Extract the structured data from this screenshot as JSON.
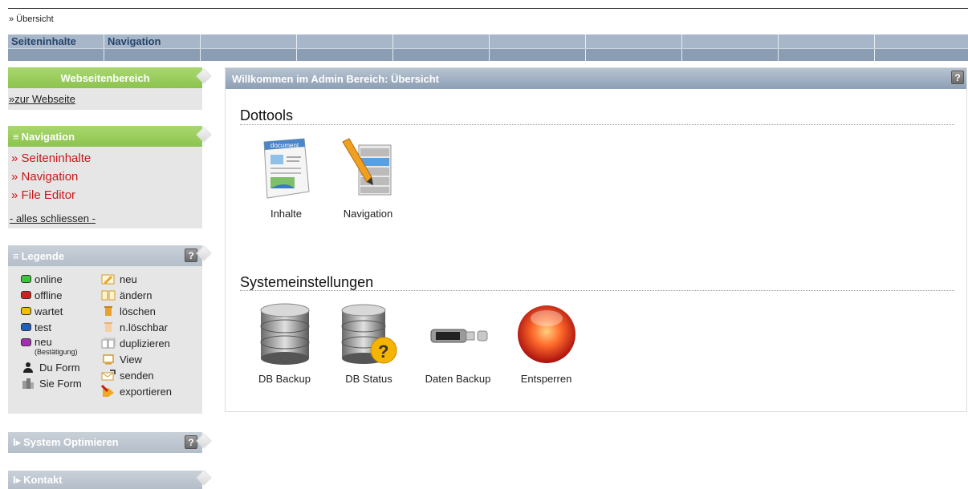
{
  "breadcrumb": "» Übersicht",
  "topnav": {
    "items": [
      "Seiteninhalte",
      "Navigation",
      "",
      "",
      "",
      "",
      "",
      "",
      "",
      ""
    ]
  },
  "sidebar": {
    "webseitenbereich": {
      "title": "Webseitenbereich",
      "link": "»zur Webseite"
    },
    "navigation": {
      "title": "Navigation",
      "links": [
        "» Seiteninhalte",
        "» Navigation",
        "» File Editor"
      ],
      "close_all": "- alles schliessen -"
    },
    "legende": {
      "title": "Legende",
      "left": [
        {
          "label": "online",
          "color": "#3cc43c"
        },
        {
          "label": "offline",
          "color": "#d02020"
        },
        {
          "label": "wartet",
          "color": "#f0c000"
        },
        {
          "label": "test",
          "color": "#1f5fb8"
        },
        {
          "label": "neu",
          "sub": "(Bestätigung)",
          "color": "#a030b0"
        },
        {
          "label": "Du Form",
          "icon": "person-icon"
        },
        {
          "label": "Sie Form",
          "icon": "building-icon"
        }
      ],
      "right": [
        {
          "label": "neu",
          "icon": "pencil-icon"
        },
        {
          "label": "ändern",
          "icon": "book-icon"
        },
        {
          "label": "löschen",
          "icon": "trash-icon"
        },
        {
          "label": "n.löschbar",
          "icon": "trash-disabled-icon"
        },
        {
          "label": "duplizieren",
          "icon": "duplicate-icon"
        },
        {
          "label": "View",
          "icon": "monitor-icon"
        },
        {
          "label": "senden",
          "icon": "envelope-icon"
        },
        {
          "label": "exportieren",
          "icon": "export-icon"
        }
      ]
    },
    "system": {
      "title": "System Optimieren"
    },
    "kontakt": {
      "title": "Kontakt"
    }
  },
  "main": {
    "title": "Willkommen im Admin Bereich: Übersicht",
    "dottools": {
      "title": "Dottools",
      "tiles": [
        {
          "label": "Inhalte",
          "icon": "document-icon"
        },
        {
          "label": "Navigation",
          "icon": "navigation-icon"
        }
      ]
    },
    "system": {
      "title": "Systemeinstellungen",
      "tiles": [
        {
          "label": "DB Backup",
          "icon": "database-icon"
        },
        {
          "label": "DB Status",
          "icon": "database-status-icon"
        },
        {
          "label": "Daten Backup",
          "icon": "usb-drive-icon"
        },
        {
          "label": "Entsperren",
          "icon": "alarm-light-icon"
        }
      ]
    }
  }
}
